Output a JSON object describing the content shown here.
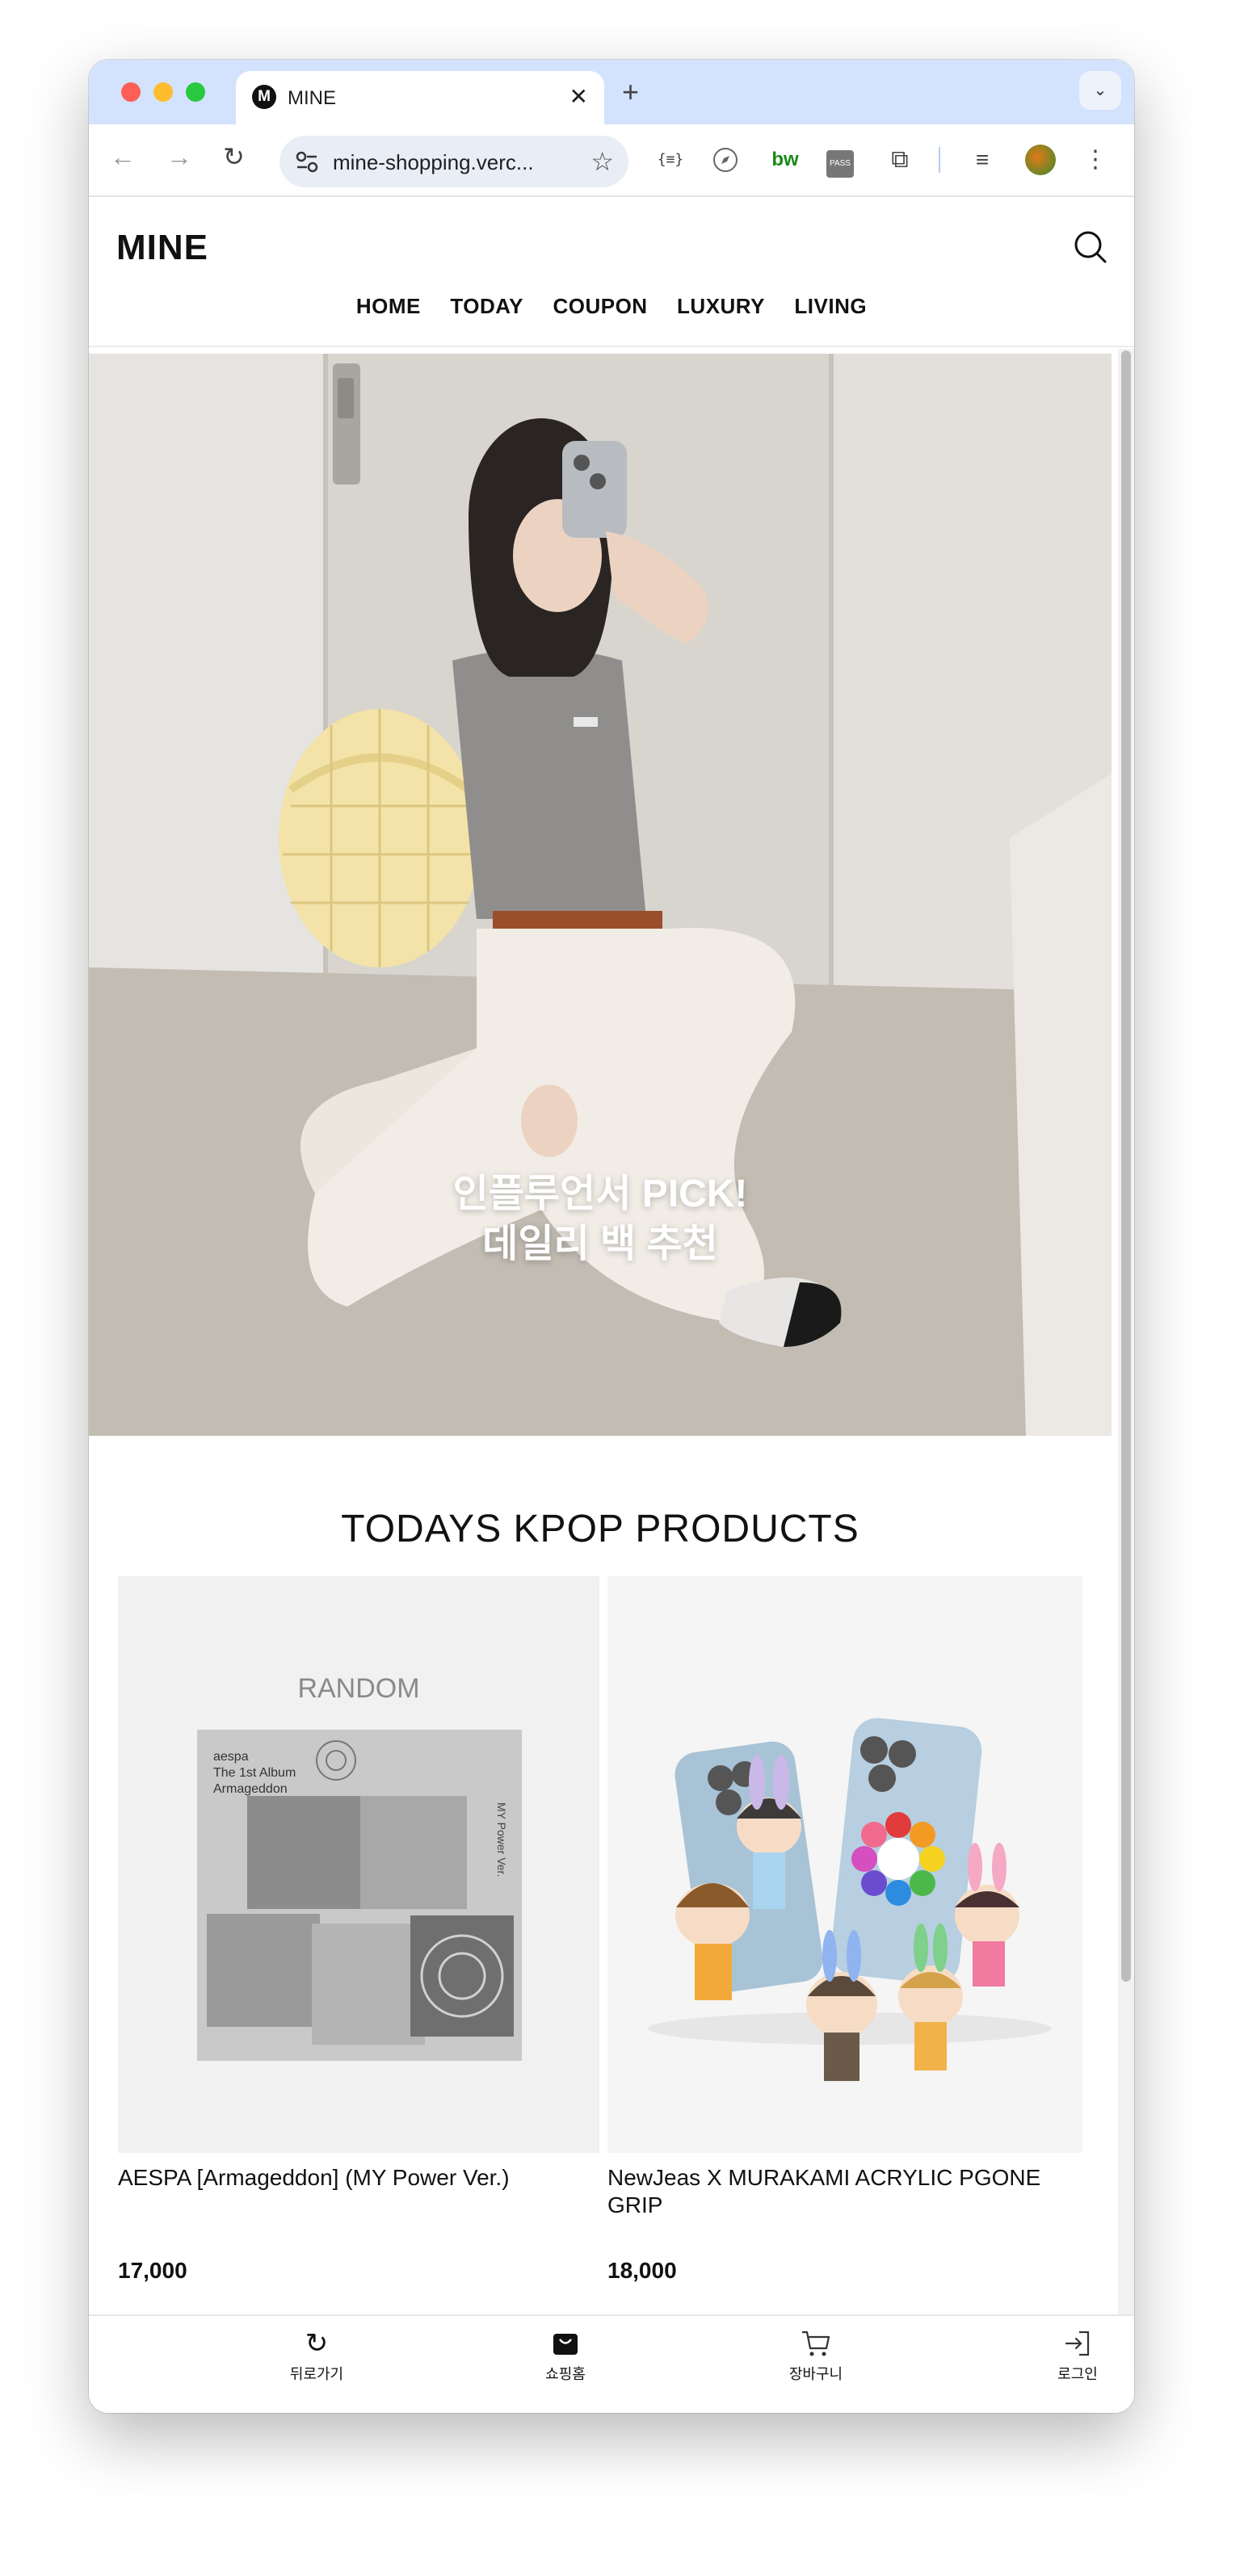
{
  "browser": {
    "tab": {
      "favicon": "M",
      "title": "MINE",
      "close_glyph": "✕"
    },
    "new_tab_glyph": "+",
    "tab_menu_glyph": "⌄",
    "url": "mine-shopping.verc...",
    "icons": [
      "back-arrow-icon",
      "forward-arrow-icon",
      "reload-icon",
      "site-settings-icon",
      "bookmark-star-icon",
      "extension-json-icon",
      "extension-compass-icon",
      "extension-bw-icon",
      "extension-pass-icon",
      "extensions-puzzle-icon",
      "reading-list-icon",
      "profile-avatar-icon",
      "more-menu-icon"
    ],
    "extensions": {
      "json": "{≡}",
      "bw": "bw",
      "pass": "PASS"
    }
  },
  "site": {
    "logo": "MINE",
    "nav": [
      "HOME",
      "TODAY",
      "COUPON",
      "LUXURY",
      "LIVING"
    ]
  },
  "hero": {
    "caption_line1": "인플루언서 PICK!",
    "caption_line2": "데일리 백 추천"
  },
  "products_section": {
    "title": "TODAYS KPOP PRODUCTS",
    "items": [
      {
        "name": "AESPA [Armageddon] (MY Power Ver.)",
        "price": "17,000",
        "image_label": "RANDOM",
        "album_text": "aespa\nThe 1st Album\nArmageddon",
        "album_side": "MY Power Ver."
      },
      {
        "name": "NewJeas X MURAKAMI ACRYLIC PGONE GRIP",
        "price": "18,000"
      }
    ]
  },
  "bottom_nav": [
    {
      "label": "뒤로가기",
      "icon": "redo-arrow-icon"
    },
    {
      "label": "쇼핑홈",
      "icon": "shopping-bag-icon"
    },
    {
      "label": "장바구니",
      "icon": "cart-icon"
    },
    {
      "label": "로그인",
      "icon": "login-icon"
    }
  ]
}
